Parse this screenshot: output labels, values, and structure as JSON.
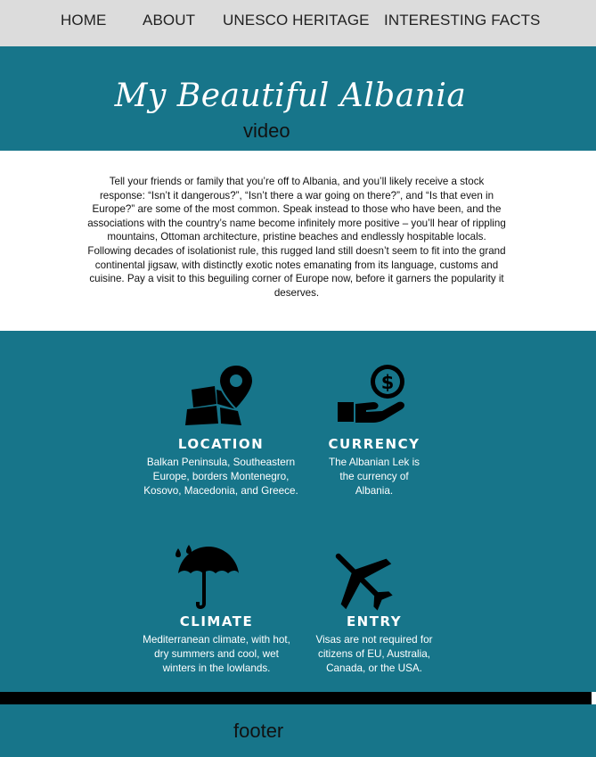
{
  "nav": {
    "items": [
      "HOME",
      "ABOUT",
      "UNESCO HERITAGE",
      "INTERESTING FACTS"
    ]
  },
  "hero": {
    "title": "My Beautiful Albania",
    "video_label": "video"
  },
  "intro": {
    "text": "Tell your friends or family that you’re off to Albania, and you’ll likely receive a stock response: “Isn’t it dangerous?”, “Isn’t there a war going on there?”, and “Is that even in Europe?” are some of the most common. Speak instead to those who have been, and the associations with the country’s name become infinitely more positive – you’ll hear of rippling mountains, Ottoman architecture, pristine beaches and endlessly hospitable locals. Following decades of isolationist rule, this rugged land still doesn’t seem to fit into the grand continental jigsaw, with distinctly exotic notes emanating from its language, customs and cuisine. Pay a visit to this beguiling corner of Europe now, before it garners the popularity it deserves."
  },
  "facts": [
    {
      "title": "LOCATION",
      "icon": "map-pin-icon",
      "text": "Balkan Peninsula, Southeastern Europe, borders Montenegro, Kosovo, Macedonia, and Greece."
    },
    {
      "title": "CURRENCY",
      "icon": "money-hand-icon",
      "text": "The Albanian Lek is the currency of Albania."
    },
    {
      "title": "CLIMATE",
      "icon": "umbrella-rain-icon",
      "text": "Mediterranean climate, with hot, dry summers and cool, wet winters in the lowlands."
    },
    {
      "title": "ENTRY",
      "icon": "airplane-icon",
      "text": "Visas are not required for citizens of EU, Australia, Canada, or the USA."
    }
  ],
  "footer": {
    "label": "footer"
  },
  "colors": {
    "teal": "#17758a",
    "nav_bg": "#dcdcdc",
    "bar": "#000000"
  }
}
